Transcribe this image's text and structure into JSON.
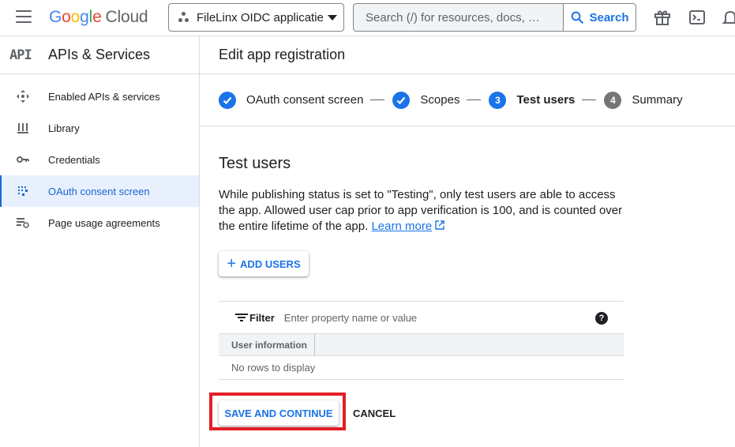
{
  "topbar": {
    "logo": {
      "g": "G",
      "o1": "o",
      "o2": "o",
      "g2": "g",
      "l": "l",
      "e": "e",
      "cloud": "Cloud"
    },
    "project_name": "FileLinx OIDC applicatie",
    "search_placeholder": "Search (/) for resources, docs, …",
    "search_button": "Search",
    "icons": [
      "menu-icon",
      "gift-icon",
      "terminal-icon",
      "notifications-icon"
    ]
  },
  "sidebar": {
    "badge": "API",
    "title": "APIs & Services",
    "items": [
      {
        "label": "Enabled APIs & services",
        "icon": "enabled-apis-icon",
        "active": false
      },
      {
        "label": "Library",
        "icon": "library-icon",
        "active": false
      },
      {
        "label": "Credentials",
        "icon": "key-icon",
        "active": false
      },
      {
        "label": "OAuth consent screen",
        "icon": "oauth-consent-icon",
        "active": true
      },
      {
        "label": "Page usage agreements",
        "icon": "settings-list-icon",
        "active": false
      }
    ]
  },
  "main": {
    "page_title": "Edit app registration",
    "steps": [
      {
        "label": "OAuth consent screen",
        "state": "done"
      },
      {
        "label": "Scopes",
        "state": "done"
      },
      {
        "number": "3",
        "label": "Test users",
        "state": "current"
      },
      {
        "number": "4",
        "label": "Summary",
        "state": "future"
      }
    ],
    "section_title": "Test users",
    "description": "While publishing status is set to \"Testing\", only test users are able to access the app. Allowed user cap prior to app verification is 100, and is counted over the entire lifetime of the app.",
    "learn_more": "Learn more",
    "add_users_label": "ADD USERS",
    "filter": {
      "label": "Filter",
      "placeholder": "Enter property name or value",
      "help": "?"
    },
    "table": {
      "columns": [
        "User information"
      ],
      "empty_text": "No rows to display"
    },
    "save_label": "SAVE AND CONTINUE",
    "cancel_label": "CANCEL"
  },
  "colors": {
    "accent": "#1a73e8",
    "highlight": "#e31e25",
    "active_bg": "#e8f0fe"
  }
}
